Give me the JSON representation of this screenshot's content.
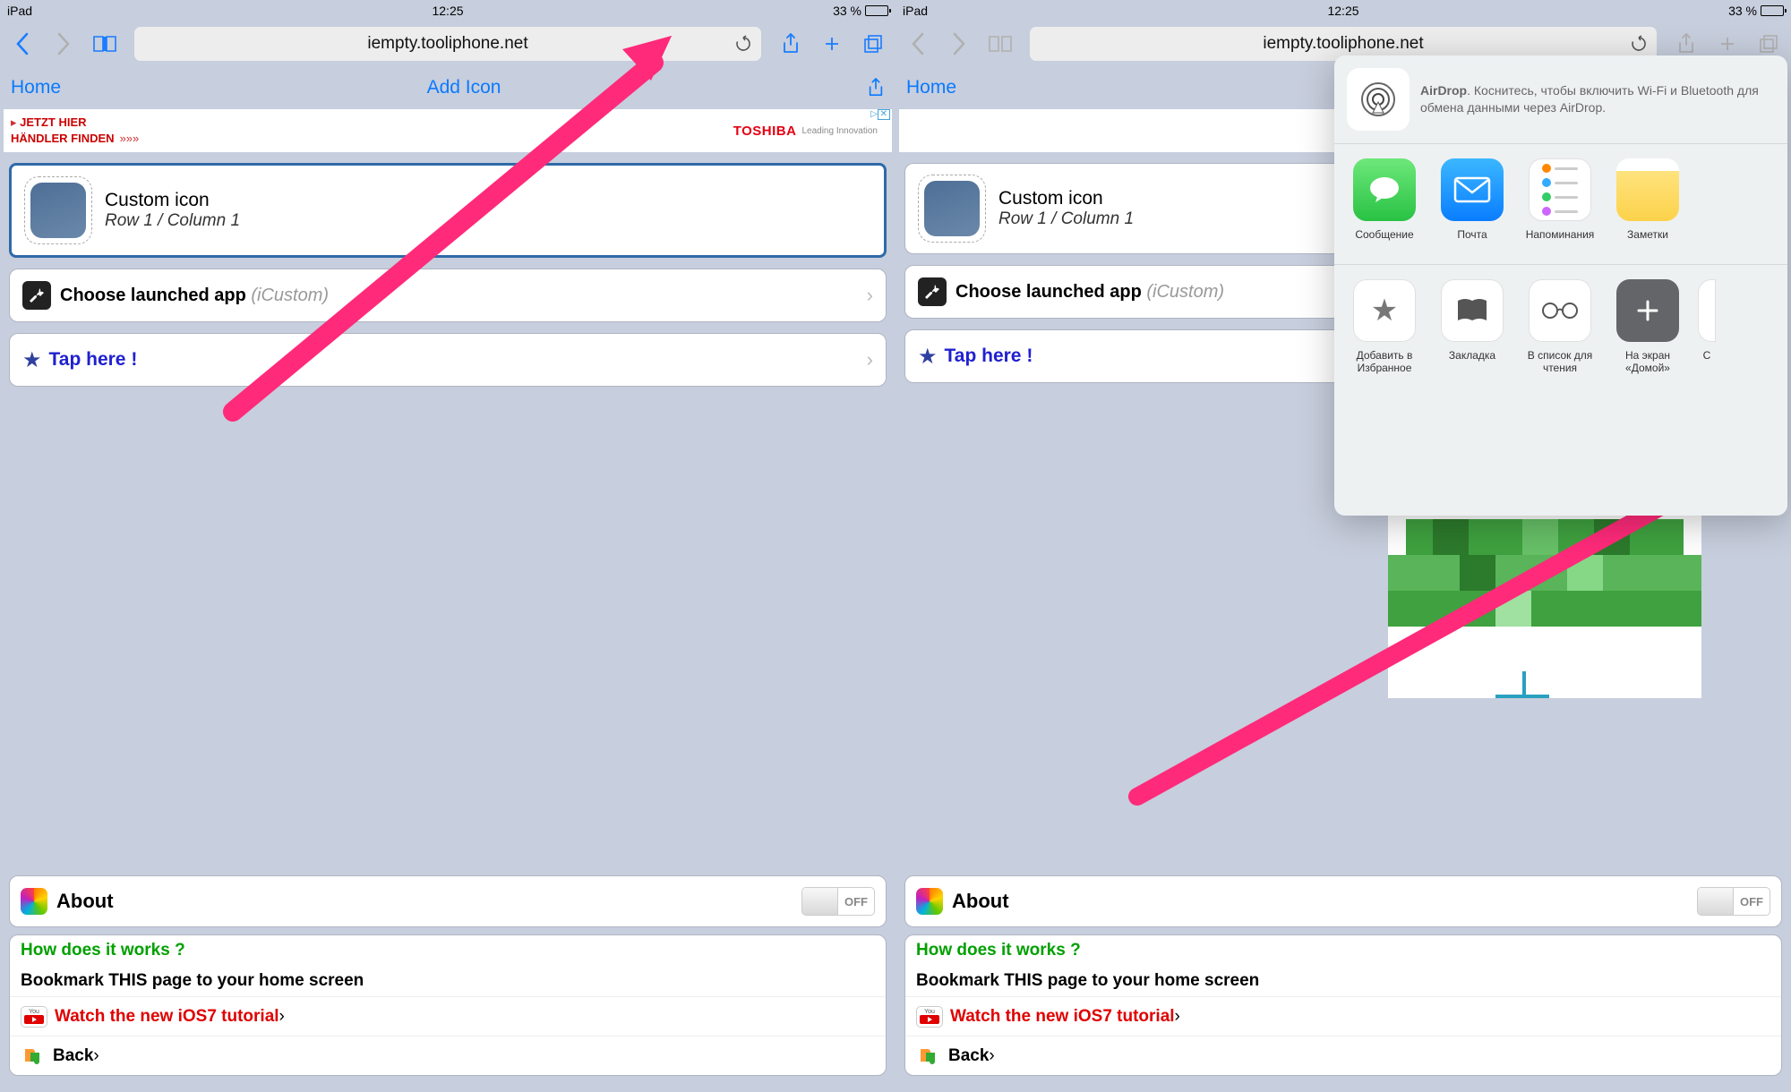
{
  "status": {
    "device": "iPad",
    "time": "12:25",
    "battery": "33 %"
  },
  "toolbar": {
    "url": "iempty.tooliphone.net"
  },
  "page": {
    "home": "Home",
    "title": "Add Icon",
    "custom_title": "Custom icon",
    "custom_sub": "Row 1 / Column 1",
    "choose_label": "Choose launched app",
    "choose_hint": "(iCustom)",
    "tap_label": "Tap here !",
    "about_label": "About",
    "switch_state": "OFF",
    "how_title": "How does it works ?",
    "how_sub": "Bookmark THIS page to your home screen",
    "tutorial": "Watch the new iOS7 tutorial",
    "back": "Back"
  },
  "ad": {
    "line1": "JETZT HIER",
    "line2": "HÄNDLER FINDEN",
    "brand": "TOSHIBA",
    "tagline": "Leading Innovation"
  },
  "popover": {
    "airdrop_title": "AirDrop",
    "airdrop_text": ". Коснитесь, чтобы включить Wi-Fi и Bluetooth для обмена данными через AirDrop.",
    "apps": [
      {
        "id": "messages",
        "label": "Сообщение"
      },
      {
        "id": "mail",
        "label": "Почта"
      },
      {
        "id": "reminders",
        "label": "Напоминания"
      },
      {
        "id": "notes",
        "label": "Заметки"
      }
    ],
    "actions": [
      {
        "id": "favorite",
        "label": "Добавить в Избранное"
      },
      {
        "id": "bookmark",
        "label": "Закладка"
      },
      {
        "id": "readlist",
        "label": "В список для чтения"
      },
      {
        "id": "homescreen",
        "label": "На экран «Домой»"
      },
      {
        "id": "more",
        "label": "С"
      }
    ]
  }
}
